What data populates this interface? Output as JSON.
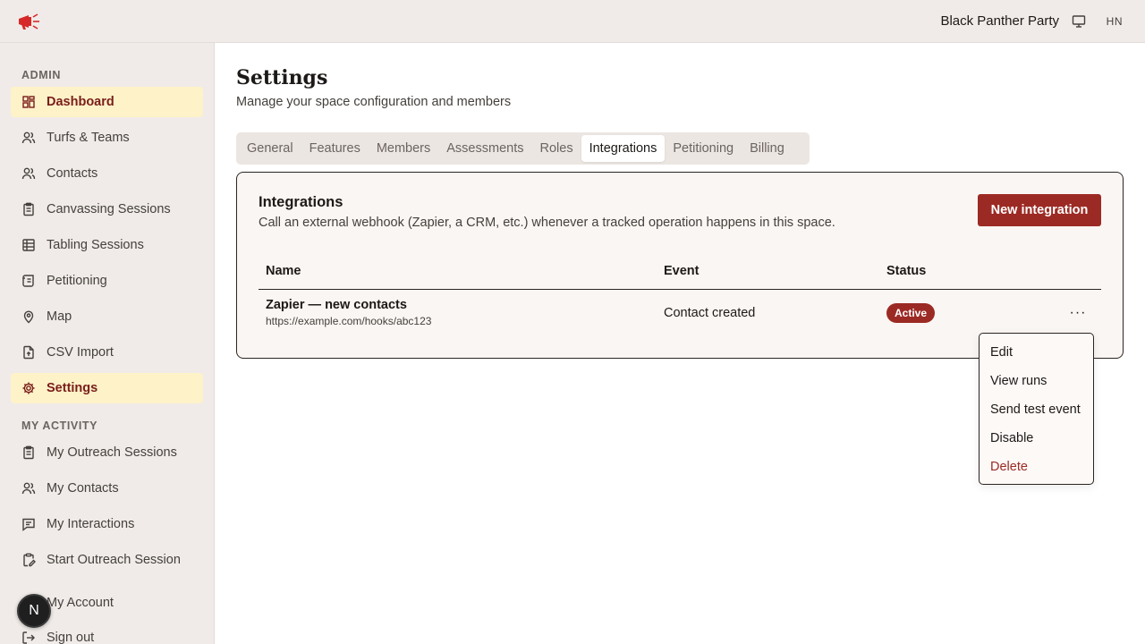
{
  "app": {
    "space_name": "Black Panther Party",
    "user_initials": "HN",
    "brand_color": "#9c2a24"
  },
  "sidebar": {
    "admin_label": "ADMIN",
    "admin_items": [
      {
        "label": "Dashboard",
        "icon": "dashboard-icon",
        "active": true
      },
      {
        "label": "Turfs & Teams",
        "icon": "users-icon"
      },
      {
        "label": "Contacts",
        "icon": "users-icon"
      },
      {
        "label": "Canvassing Sessions",
        "icon": "clipboard-icon"
      },
      {
        "label": "Tabling Sessions",
        "icon": "table-icon"
      },
      {
        "label": "Petitioning",
        "icon": "scroll-icon"
      },
      {
        "label": "Map",
        "icon": "map-pin-icon"
      },
      {
        "label": "CSV Import",
        "icon": "file-upload-icon"
      },
      {
        "label": "Settings",
        "icon": "gear-icon",
        "active": true
      }
    ],
    "activity_label": "MY ACTIVITY",
    "activity_items": [
      {
        "label": "My Outreach Sessions",
        "icon": "clipboard-icon"
      },
      {
        "label": "My Contacts",
        "icon": "users-icon"
      },
      {
        "label": "My Interactions",
        "icon": "message-icon"
      },
      {
        "label": "Start Outreach Session",
        "icon": "clipboard-edit-icon"
      }
    ],
    "account_items": [
      {
        "label": "My Account",
        "icon": "user-icon"
      },
      {
        "label": "Sign out",
        "icon": "sign-out-icon"
      }
    ],
    "floating_avatar": "N"
  },
  "page": {
    "title": "Settings",
    "subtitle": "Manage your space configuration and members",
    "tabs": [
      {
        "label": "General"
      },
      {
        "label": "Features"
      },
      {
        "label": "Members"
      },
      {
        "label": "Assessments"
      },
      {
        "label": "Roles"
      },
      {
        "label": "Integrations",
        "active": true
      },
      {
        "label": "Petitioning"
      },
      {
        "label": "Billing"
      }
    ]
  },
  "integrations": {
    "title": "Integrations",
    "description": "Call an external webhook (Zapier, a CRM, etc.) whenever a tracked operation happens in this space.",
    "new_button": "New integration",
    "columns": {
      "name": "Name",
      "event": "Event",
      "status": "Status"
    },
    "rows": [
      {
        "name": "Zapier — new contacts",
        "url": "https://example.com/hooks/abc123",
        "event": "Contact created",
        "status": "Active",
        "more": "···"
      }
    ]
  },
  "row_menu": {
    "items": [
      "Edit",
      "View runs",
      "Send test event",
      "Disable",
      "Delete"
    ]
  }
}
